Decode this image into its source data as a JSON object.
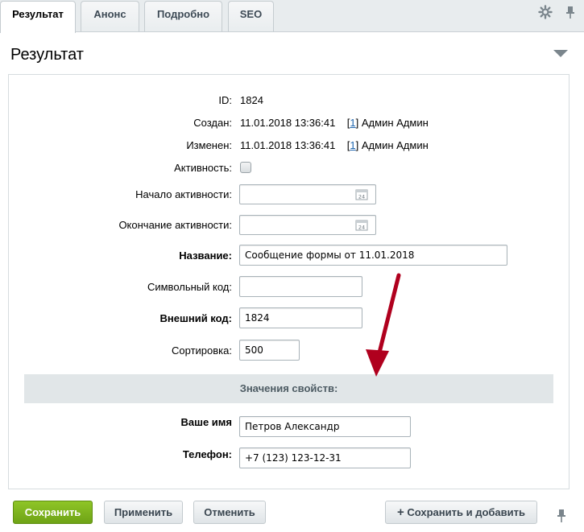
{
  "tabs": [
    {
      "label": "Результат",
      "active": true
    },
    {
      "label": "Анонс",
      "active": false
    },
    {
      "label": "Подробно",
      "active": false
    },
    {
      "label": "SEO",
      "active": false
    }
  ],
  "section": {
    "title": "Результат"
  },
  "form": {
    "id_label": "ID:",
    "id_value": "1824",
    "created_label": "Создан:",
    "created_value": "11.01.2018 13:36:41",
    "created_user_bracket_open": "[",
    "created_user_id": "1",
    "created_user_bracket_close": "]",
    "created_user_name": "Админ Админ",
    "modified_label": "Изменен:",
    "modified_value": "11.01.2018 13:36:41",
    "modified_user_bracket_open": "[",
    "modified_user_id": "1",
    "modified_user_bracket_close": "]",
    "modified_user_name": "Админ Админ",
    "active_label": "Активность:",
    "active_from_label": "Начало активности:",
    "active_from_value": "",
    "active_to_label": "Окончание активности:",
    "active_to_value": "",
    "name_label": "Название:",
    "name_value": "Сообщение формы от 11.01.2018",
    "code_label": "Символьный код:",
    "code_value": "",
    "xml_id_label": "Внешний код:",
    "xml_id_value": "1824",
    "sort_label": "Сортировка:",
    "sort_value": "500",
    "props_header": "Значения свойств:",
    "your_name_label": "Ваше имя",
    "your_name_value": "Петров Александр",
    "phone_label": "Телефон:",
    "phone_value": "+7 (123) 123-12-31"
  },
  "buttons": {
    "save": "Сохранить",
    "apply": "Применить",
    "cancel": "Отменить",
    "save_and_add": "Сохранить и добавить"
  },
  "colors": {
    "primary_button": "#7bb51d",
    "link": "#2067b0",
    "annotation_arrow": "#b0001e"
  }
}
